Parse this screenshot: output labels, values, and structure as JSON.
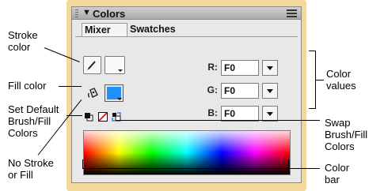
{
  "panel": {
    "title": "Colors",
    "tabs": [
      {
        "label": "Mixer"
      },
      {
        "label": "Swatches"
      }
    ],
    "rgb": [
      {
        "label": "R:",
        "value": "F0"
      },
      {
        "label": "G:",
        "value": "F0"
      },
      {
        "label": "B:",
        "value": "F0"
      }
    ],
    "fill_color": "#1e90ff"
  },
  "callouts": {
    "stroke_color": [
      "Stroke",
      "color"
    ],
    "fill_color": "Fill color",
    "set_default": [
      "Set Default",
      "Brush/Fill",
      "Colors"
    ],
    "no_stroke": [
      "No Stroke",
      "or Fill"
    ],
    "color_values": [
      "Color",
      "values"
    ],
    "swap": [
      "Swap",
      "Brush/Fill",
      "Colors"
    ],
    "color_bar": [
      "Color",
      "bar"
    ]
  },
  "icons": [
    "grip-icon",
    "collapse-arrow-icon",
    "options-menu-icon",
    "pencil-icon",
    "paint-bucket-icon",
    "default-colors-icon",
    "no-color-icon",
    "swap-colors-icon"
  ]
}
